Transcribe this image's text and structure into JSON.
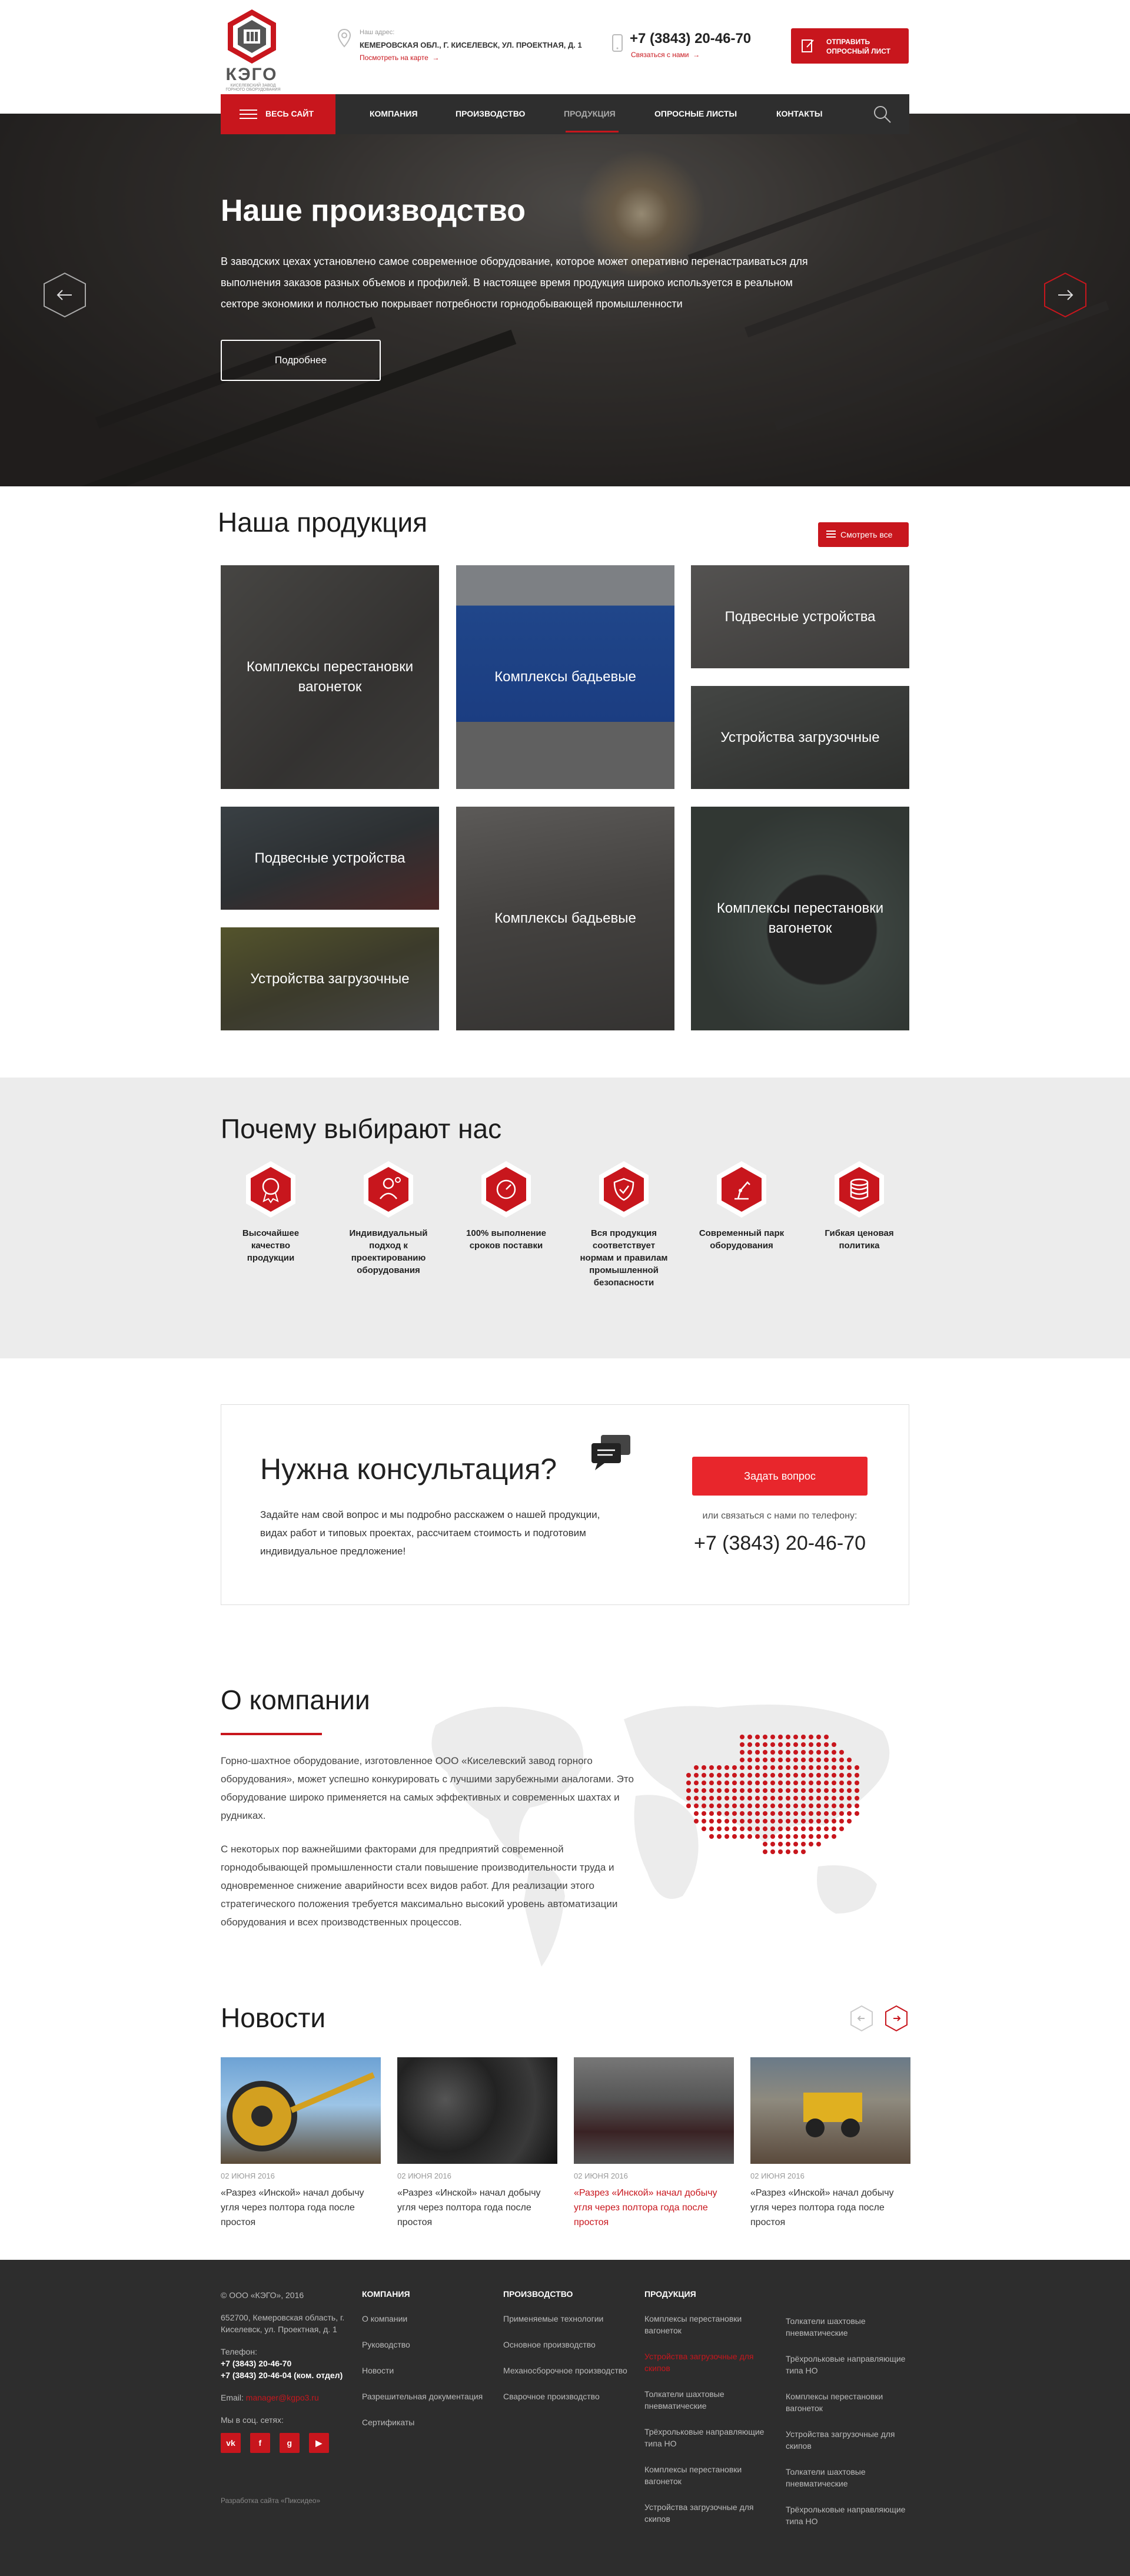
{
  "header": {
    "brand": "КЭГО",
    "brand_sub": "КИСЕЛЕВСКИЙ ЗАВОД ГОРНОГО ОБОРУДОВАНИЯ",
    "address_label": "Наш адрес:",
    "address": "КЕМЕРОВСКАЯ ОБЛ., Г. КИСЕЛЕВСК, УЛ. ПРОЕКТНАЯ, Д. 1",
    "map_link": "Посмотреть на карте",
    "phone": "+7 (3843) 20-46-70",
    "callback": "Связаться с нами",
    "send_btn": "ОТПРАВИТЬ ОПРОСНЫЙ ЛИСТ"
  },
  "nav": {
    "all_site": "ВЕСЬ САЙТ",
    "items": [
      "КОМПАНИЯ",
      "ПРОИЗВОДСТВО",
      "ПРОДУКЦИЯ",
      "ОПРОСНЫЕ ЛИСТЫ",
      "КОНТАКТЫ"
    ]
  },
  "hero": {
    "title": "Наше производство",
    "text": "В заводских цехах установлено самое современное оборудование, которое может оперативно перенастраиваться для выполнения заказов разных объемов и профилей. В настоящее время продукция широко используется в реальном секторе экономики и полностью покрывает потребности горнодобывающей промышленности",
    "button": "Подробнее"
  },
  "products": {
    "title": "Наша продукция",
    "see_all": "Смотреть все",
    "tiles": [
      "Комплексы перестановки вагонеток",
      "Комплексы бадьевые",
      "Подвесные устройства",
      "Устройства загрузочные",
      "Подвесные устройства",
      "Комплексы бадьевые",
      "Комплексы перестановки вагонеток",
      "Устройства загрузочные"
    ]
  },
  "why": {
    "title": "Почему выбирают нас",
    "items": [
      "Высочайшее качество продукции",
      "Индивидуальный подход к проектированию оборудования",
      "100% выполнение сроков поставки",
      "Вся продукция соответствует нормам и правилам промышленной безопасности",
      "Современный парк оборудования",
      "Гибкая ценовая политика"
    ]
  },
  "consult": {
    "title": "Нужна консультация?",
    "text": "Задайте нам свой вопрос и мы подробно расскажем о нашей продукции, видах работ и типовых проектах, рассчитаем стоимость и подготовим индивидуальное предложение!",
    "button": "Задать вопрос",
    "or_call": "или связаться с нами по телефону:",
    "phone": "+7 (3843) 20-46-70"
  },
  "about": {
    "title": "О компании",
    "p1": "Горно-шахтное оборудование, изготовленное ООО «Киселевский завод горного оборудования», может успешно конкурировать с лучшими зарубежными аналогами. Это оборудование широко применяется на самых эффективных и современных шахтах и рудниках.",
    "p2": "С некоторых пор важнейшими факторами для предприятий современной горнодобывающей промышленности стали повышение производительности труда и одновременное снижение аварийности всех видов работ. Для реализации этого стратегического положения требуется максимально высокий уровень автоматизации оборудования и всех производственных процессов."
  },
  "news": {
    "title": "Новости",
    "items": [
      {
        "date": "02 ИЮНЯ 2016",
        "title": "«Разрез «Инской» начал добычу угля через полтора года после простоя"
      },
      {
        "date": "02 ИЮНЯ 2016",
        "title": "«Разрез «Инской» начал добычу угля через полтора года после простоя"
      },
      {
        "date": "02 ИЮНЯ 2016",
        "title": "«Разрез «Инской» начал добычу угля через полтора года после простоя"
      },
      {
        "date": "02 ИЮНЯ 2016",
        "title": "«Разрез «Инской» начал добычу угля через полтора года после простоя"
      }
    ]
  },
  "footer": {
    "copyright": "© ООО «КЭГО», 2016",
    "address": "652700, Кемеровская область, г. Киселевск, ул. Проектная, д. 1",
    "phones_label": "Телефон:",
    "phone1": "+7 (3843) 20-46-70",
    "phone2": "+7 (3843) 20-46-04 (ком. отдел)",
    "email_label": "Email:",
    "email": "manager@kgpo3.ru",
    "social_label": "Мы в соц. сетях:",
    "social": [
      "vk",
      "f",
      "g",
      "yt"
    ],
    "developer": "Разработка сайта «Пиксидео»",
    "col_company": {
      "title": "КОМПАНИЯ",
      "links": [
        "О компании",
        "Руководство",
        "Новости",
        "Разрешительная документация",
        "Сертификаты"
      ]
    },
    "col_production": {
      "title": "ПРОИЗВОДСТВО",
      "links": [
        "Применяемые технологии",
        "Основное производство",
        "Механосборочное производство",
        "Сварочное производство"
      ]
    },
    "col_products": {
      "title": "ПРОДУКЦИЯ",
      "left": [
        "Комплексы перестановки вагонеток",
        "Устройства загрузочные для скипов",
        "Толкатели шахтовые пневматические",
        "Трёхрольковые направляющие типа НО",
        "Комплексы перестановки вагонеток",
        "Устройства загрузочные для скипов"
      ],
      "right": [
        "Толкатели шахтовые пневматические",
        "Трёхрольковые направляющие типа НО",
        "Комплексы перестановки вагонеток",
        "Устройства загрузочные для скипов",
        "Толкатели шахтовые пневматические",
        "Трёхрольковые направляющие типа НО"
      ]
    }
  },
  "colors": {
    "accent": "#c8161d",
    "dark": "#2e2e2e",
    "light_bg": "#ececec"
  }
}
